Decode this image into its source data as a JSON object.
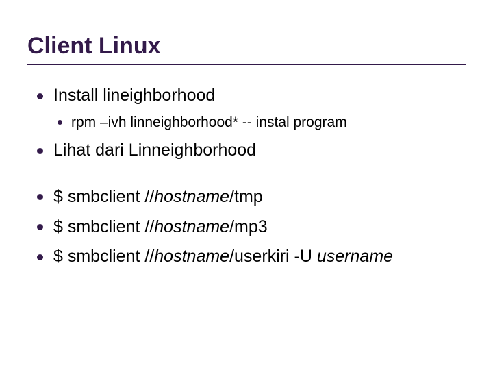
{
  "title": "Client Linux",
  "b1": {
    "text": "Install lineighborhood",
    "sub1": "rpm –ivh linneighborhood*   -- instal program"
  },
  "b2": "Lihat dari Linneighborhood",
  "b3": {
    "pre": "$ smbclient //",
    "host": "hostname",
    "post": "/tmp"
  },
  "b4": {
    "pre": "$ smbclient //",
    "host": "hostname",
    "post": "/mp3"
  },
  "b5": {
    "pre": "$ smbclient //",
    "host": "hostname",
    "mid": "/userkiri -U ",
    "user": "username"
  }
}
